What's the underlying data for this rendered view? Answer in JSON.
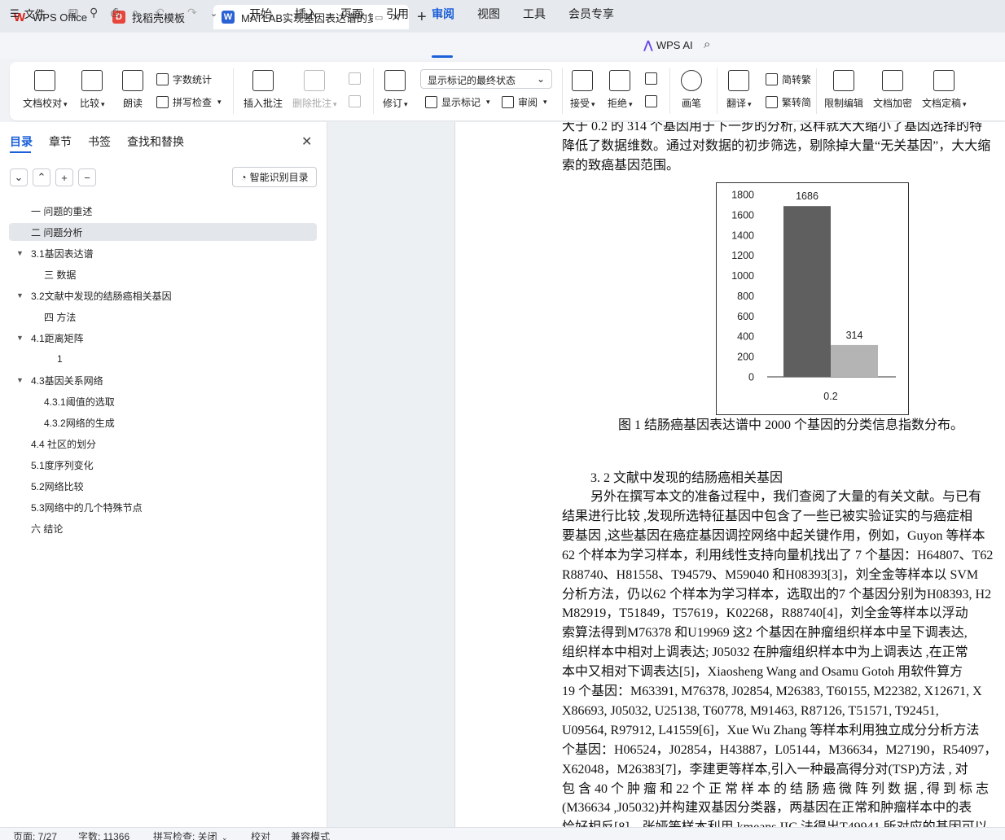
{
  "tabs": {
    "wps": "WPS Office",
    "templates": "找稻壳模板",
    "document": "MATLAB实现基因表达谱的复"
  },
  "menu": {
    "file": "文件",
    "items": [
      "开始",
      "插入",
      "页面",
      "引用",
      "审阅",
      "视图",
      "工具",
      "会员专享"
    ],
    "active": "审阅",
    "ai": "WPS AI"
  },
  "ribbon": {
    "doc_check": "文档校对",
    "compare": "比较",
    "read_aloud": "朗读",
    "word_count": "字数统计",
    "spell_check": "拼写检查",
    "insert_comment": "插入批注",
    "delete_comment": "删除批注",
    "track": "修订",
    "markup_state": "显示标记的最终状态",
    "show_markup": "显示标记",
    "review": "审阅",
    "accept": "接受",
    "reject": "拒绝",
    "pen": "画笔",
    "translate": "翻译",
    "to_traditional": "简转繁",
    "to_simplified": "繁转简",
    "restrict_edit": "限制编辑",
    "encrypt": "文档加密",
    "finalize": "文档定稿"
  },
  "nav": {
    "tabs": [
      "目录",
      "章节",
      "书签",
      "查找和替换"
    ],
    "smart_toc": "智能识别目录",
    "toc": [
      {
        "label": "一 问题的重述",
        "level": 1
      },
      {
        "label": "二 问题分析",
        "level": 1,
        "selected": true
      },
      {
        "label": "3.1基因表达谱",
        "level": 1,
        "expanded": true
      },
      {
        "label": "三 数据",
        "level": 2
      },
      {
        "label": "3.2文献中发现的结肠癌相关基因",
        "level": 1,
        "expanded": true
      },
      {
        "label": "四 方法",
        "level": 2
      },
      {
        "label": "4.1距离矩阵",
        "level": 1,
        "expanded": true
      },
      {
        "label": "1",
        "level": 3
      },
      {
        "label": "4.3基因关系网络",
        "level": 1,
        "expanded": true
      },
      {
        "label": "4.3.1阈值的选取",
        "level": 2
      },
      {
        "label": "4.3.2网络的生成",
        "level": 2
      },
      {
        "label": "4.4 社区的划分",
        "level": 1
      },
      {
        "label": "5.1度序列变化",
        "level": 1
      },
      {
        "label": "5.2网络比较",
        "level": 1
      },
      {
        "label": "5.3网络中的几个特殊节点",
        "level": 1
      },
      {
        "label": "六 结论",
        "level": 1
      }
    ]
  },
  "document": {
    "para1": [
      "大于 0.2 的 314 个基因用于下一步的分析, 这样就大大缩小了基因选择的特",
      "降低了数据维数。通过对数据的初步筛选，剔除掉大量“无关基因”，大大缩",
      "索的致癌基因范围。"
    ],
    "caption": "图 1 结肠癌基因表达谱中 2000 个基因的分类信息指数分布。",
    "heading": "3. 2  文献中发现的结肠癌相关基因",
    "para2": [
      "另外在撰写本文的准备过程中，我们查阅了大量的有关文献。与已有",
      "结果进行比较 ,发现所选特征基因中包含了一些已被实验证实的与癌症相",
      "要基因 ,这些基因在癌症基因调控网络中起关键作用，例如，Guyon 等样本",
      "62 个样本为学习样本，利用线性支持向量机找出了 7 个基因：H64807、T62",
      "R88740、H81558、T94579、M59040 和H08393[3]，刘全金等样本以 SVM",
      "分析方法，仍以62 个样本为学习样本，选取出的7 个基因分别为H08393, H2",
      "M82919，T51849，T57619，K02268，R88740[4]，刘全金等样本以浮动",
      "索算法得到M76378 和U19969 这2 个基因在肿瘤组织样本中呈下调表达,",
      "组织样本中相对上调表达; J05032 在肿瘤组织样本中为上调表达 ,在正常",
      "本中又相对下调表达[5]，Xiaosheng Wang and Osamu Gotoh 用软件算方",
      "19 个基因：M63391, M76378, J02854, M26383, T60155, M22382, X12671, X",
      "X86693, J05032, U25138, T60778, M91463, R87126, T51571, T92451,",
      "U09564, R97912, L41559[6]，Xue Wu Zhang 等样本利用独立成分分析方法",
      "个基因：H06524，J02854，H43887，L05144，M36634，M27190，R54097，",
      "X62048，M26383[7]，李建更等样本,引入一种最高得分对(TSP)方法 , 对",
      "包 含  40 个 肿 瘤 和  22 个 正 常 样 本 的 结 肠 癌 微 阵 列 数 据  , 得 到 标 志",
      "(M36634 ,J05032)并构建双基因分类器，两基因在正常和肿瘤样本中的表",
      "恰好相反[8]，张娅等样本利用 kmeans IIC 法得出T49941 所对应的基因可以"
    ]
  },
  "chart_data": {
    "type": "bar",
    "categories": [
      "0.2"
    ],
    "series": [
      {
        "values": [
          1686
        ],
        "color": "#5f5f5f"
      },
      {
        "values": [
          314
        ],
        "color": "#b4b4b4"
      }
    ],
    "data_labels": [
      "1686",
      "314"
    ],
    "yticks": [
      0,
      200,
      400,
      600,
      800,
      1000,
      1200,
      1400,
      1600,
      1800
    ],
    "ylim": [
      0,
      1800
    ],
    "title": "",
    "xlabel": "",
    "ylabel": ""
  },
  "status": {
    "page": "页面: 7/27",
    "words": "字数: 11366",
    "spell": "拼写检查: 关闭",
    "proofread": "校对",
    "compat": "兼容模式"
  }
}
